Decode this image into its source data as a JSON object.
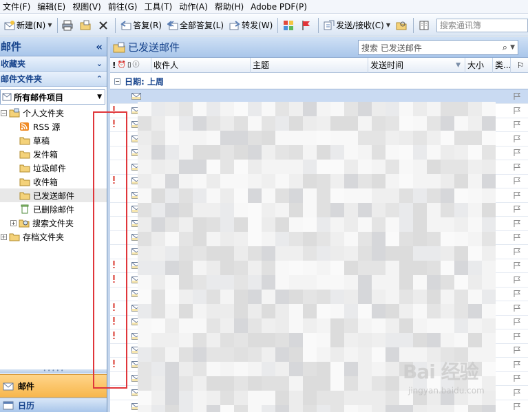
{
  "menu": [
    "文件(F)",
    "编辑(E)",
    "视图(V)",
    "前往(G)",
    "工具(T)",
    "动作(A)",
    "帮助(H)",
    "Adobe PDF(P)"
  ],
  "toolbar": {
    "new": "新建(N)",
    "reply": "答复(R)",
    "reply_all": "全部答复(L)",
    "forward": "转发(W)",
    "send_receive": "发送/接收(C)",
    "search_contacts_placeholder": "搜索通讯簿"
  },
  "nav": {
    "title": "邮件",
    "favorites": "收藏夹",
    "mail_folders": "邮件文件夹",
    "all_mail_items": "所有邮件项目",
    "folders": [
      {
        "label": "个人文件夹",
        "icon": "personal-folders-icon",
        "level": 1,
        "expand": "−"
      },
      {
        "label": "RSS 源",
        "icon": "rss-icon",
        "level": 2
      },
      {
        "label": "草稿",
        "icon": "drafts-icon",
        "level": 2
      },
      {
        "label": "发件箱",
        "icon": "outbox-icon",
        "level": 2
      },
      {
        "label": "垃圾邮件",
        "icon": "junk-icon",
        "level": 2
      },
      {
        "label": "收件箱",
        "icon": "inbox-icon",
        "level": 2
      },
      {
        "label": "已发送邮件",
        "icon": "sent-icon",
        "level": 2,
        "selected": true
      },
      {
        "label": "已删除邮件",
        "icon": "deleted-icon",
        "level": 2
      },
      {
        "label": "搜索文件夹",
        "icon": "search-folder-icon",
        "level": 2,
        "expand": "+"
      },
      {
        "label": "存档文件夹",
        "icon": "archive-icon",
        "level": 1,
        "expand": "+"
      }
    ],
    "bottom_mail": "邮件",
    "bottom_calendar": "日历"
  },
  "main": {
    "title": "已发送邮件",
    "search_placeholder": "搜索 已发送邮件",
    "columns": [
      "!",
      "收件人",
      "主题",
      "发送时间",
      "大小",
      "类..."
    ],
    "group_label": "日期: 上周"
  },
  "rows": [
    {
      "important": false,
      "selected": true
    },
    {
      "important": true
    },
    {
      "important": true
    },
    {
      "important": false
    },
    {
      "important": false
    },
    {
      "important": false
    },
    {
      "important": true
    },
    {
      "important": false
    },
    {
      "important": false
    },
    {
      "important": false
    },
    {
      "important": false
    },
    {
      "important": false
    },
    {
      "important": true
    },
    {
      "important": true
    },
    {
      "important": false
    },
    {
      "important": true
    },
    {
      "important": true
    },
    {
      "important": true
    },
    {
      "important": false
    },
    {
      "important": true
    },
    {
      "important": false
    },
    {
      "important": false
    },
    {
      "important": false
    }
  ],
  "watermark": {
    "logo": "Bai 经验",
    "site": "jingyan.baidu.com"
  },
  "colors": {
    "accent": "#15428b",
    "highlight": "#f7b64b",
    "annotation": "#e0353a"
  }
}
